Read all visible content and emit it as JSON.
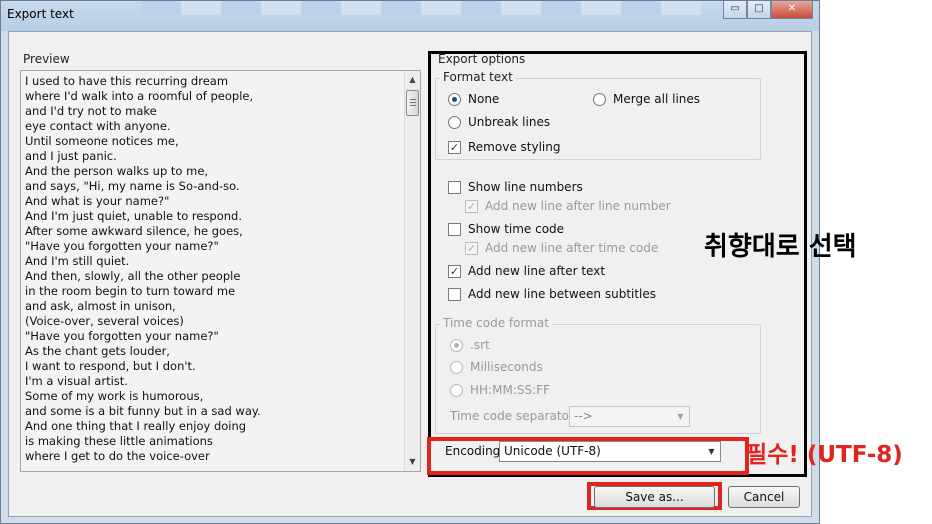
{
  "window": {
    "title": "Export text",
    "controls": {
      "minimize": "▭",
      "maximize": "□",
      "close": "✕"
    }
  },
  "preview": {
    "label": "Preview",
    "lines": [
      "I used to have this recurring dream",
      "where I'd walk into a roomful of people,",
      "and I'd try not to make",
      "eye contact with anyone.",
      "Until someone notices me,",
      "and I just panic.",
      "And the person walks up to me,",
      "and says, \"Hi, my name is So-and-so.",
      "And what is your name?\"",
      "And I'm just quiet, unable to respond.",
      "After some awkward silence, he goes,",
      "\"Have you forgotten your name?\"",
      "And I'm still quiet.",
      "And then, slowly, all the other people",
      "in the room begin to turn toward me",
      "and ask, almost in unison,",
      "(Voice-over, several voices)",
      "\"Have you forgotten your name?\"",
      "As the chant gets louder,",
      "I want to respond, but I don't.",
      "I'm a visual artist.",
      "Some of my work is humorous,",
      "and some is a bit funny but in a sad way.",
      "And one thing that I really enjoy doing",
      "is making these little animations",
      "where I get to do the voice-over"
    ]
  },
  "export_options": {
    "label": "Export options",
    "format_text": {
      "title": "Format text",
      "none": "None",
      "merge_all_lines": "Merge all lines",
      "unbreak_lines": "Unbreak lines",
      "remove_styling": "Remove styling"
    },
    "show_line_numbers": "Show line numbers",
    "add_new_line_after_line_number": "Add new line after line number",
    "show_time_code": "Show time code",
    "add_new_line_after_time_code": "Add new line after time code",
    "add_new_line_after_text": "Add new line after text",
    "add_new_line_between_subtitles": "Add new line between subtitles",
    "time_code_format": {
      "title": "Time code format",
      "srt": ".srt",
      "milliseconds": "Milliseconds",
      "hhmmssff": "HH:MM:SS:FF",
      "separator_label": "Time code separator",
      "separator_value": "-->"
    },
    "encoding_label": "Encoding",
    "encoding_value": "Unicode (UTF-8)"
  },
  "buttons": {
    "save": "Save as...",
    "cancel": "Cancel"
  },
  "annotations": {
    "choose_preference": "취향대로 선택",
    "required_utf8": "필수! (UTF-8)"
  },
  "colors": {
    "annotation_red": "#e3231d",
    "window_frame": "#cfdcea",
    "dialog_bg": "#f0f0f0"
  },
  "state": {
    "format_text_selected": "None",
    "remove_styling": true,
    "show_line_numbers": false,
    "add_new_line_after_line_number": true,
    "show_time_code": false,
    "add_new_line_after_time_code": true,
    "add_new_line_after_text": true,
    "add_new_line_between_subtitles": false,
    "time_code_format_selected": ".srt"
  }
}
